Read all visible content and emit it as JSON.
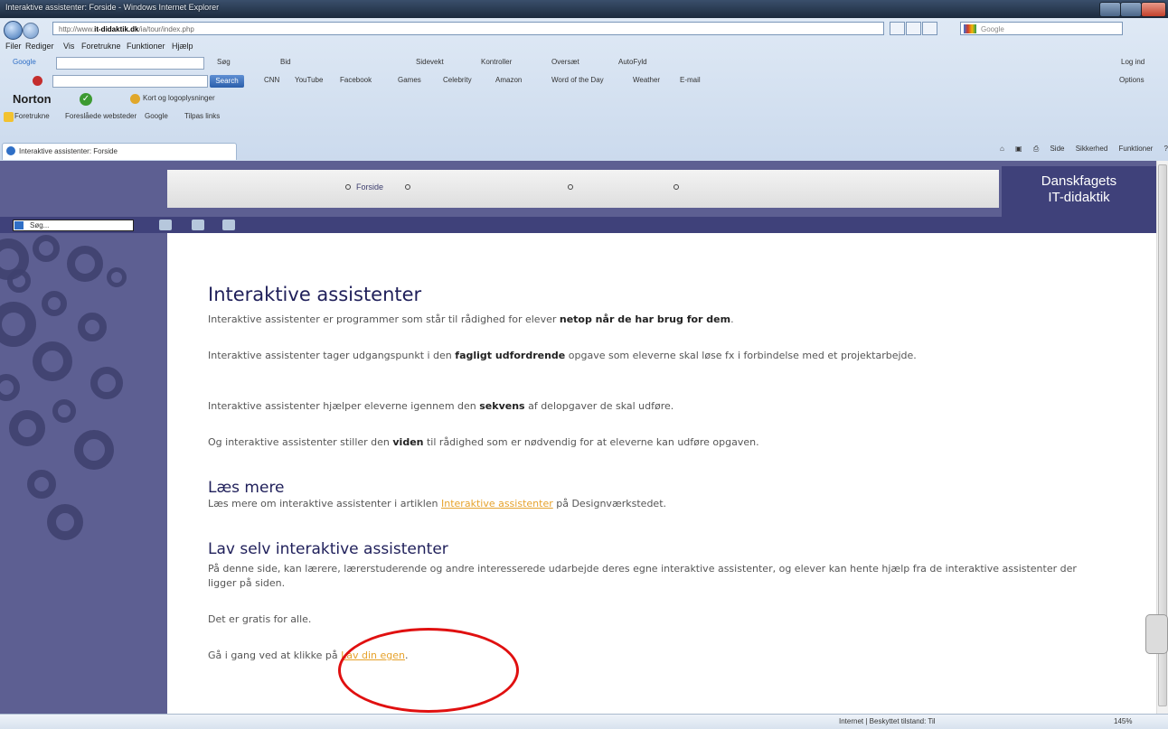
{
  "window": {
    "title": "Interaktive assistenter: Forside - Windows Internet Explorer"
  },
  "addressbar": {
    "url_prefix": "http://www.",
    "url_domain": "it-didaktik.dk",
    "url_rest": "/ia/tour/index.php",
    "search_placeholder": "Google"
  },
  "menubar": [
    "Filer",
    "Rediger",
    "Vis",
    "Foretrukne",
    "Funktioner",
    "Hjælp"
  ],
  "google_toolbar": {
    "label": "Google",
    "search_label": "Søg",
    "items": [
      "Bid",
      "Sidevekt",
      "Kontroller",
      "Oversæt",
      "AutoFyld"
    ],
    "signin": "Log ind"
  },
  "ask_toolbar": {
    "search_button": "Search",
    "items": [
      "CNN",
      "YouTube",
      "Facebook",
      "Games",
      "Celebrity",
      "Amazon",
      "Word of the Day",
      "Weather",
      "E-mail"
    ],
    "options": "Options"
  },
  "norton_toolbar": {
    "brand": "Norton",
    "item": "Kort og logoplysninger"
  },
  "favorites_bar": {
    "favorites": "Foretrukne",
    "items": [
      "Foreslåede websteder",
      "Google",
      "Tilpas links"
    ]
  },
  "tab": {
    "title": "Interaktive assistenter: Forside"
  },
  "command_bar": [
    "Side",
    "Sikkerhed",
    "Funktioner"
  ],
  "banner": {
    "nav_active": "Forside",
    "brand_line1": "Danskfagets",
    "brand_line2": "IT-didaktik"
  },
  "site_search": {
    "placeholder": "Søg..."
  },
  "content": {
    "h1": "Interaktive assistenter",
    "p1_pre": "Interaktive assistenter er programmer som står til rådighed for elever ",
    "p1_bold": "netop når de har brug for dem",
    "p1_post": ".",
    "p2_pre": "Interaktive assistenter tager udgangspunkt i den ",
    "p2_bold": "fagligt udfordrende",
    "p2_post": " opgave som eleverne skal løse fx i forbindelse med et projektarbejde.",
    "p3_pre": "Interaktive assistenter hjælper eleverne igennem den ",
    "p3_bold": "sekvens",
    "p3_post": " af delopgaver de skal udføre.",
    "p4_pre": "Og interaktive assistenter stiller den ",
    "p4_bold": "viden",
    "p4_post": " til rådighed som er nødvendig for at eleverne kan udføre opgaven.",
    "h2_read": "Læs mere",
    "read_pre": "Læs mere om interaktive assistenter i artiklen ",
    "read_link": "Interaktive assistenter",
    "read_post": " på Designværkstedet.",
    "h2_make": "Lav selv interaktive assistenter",
    "make_p1": "På denne side, kan lærere, lærerstuderende og andre interesserede udarbejde deres egne interaktive assistenter, og elever kan hente hjælp fra de interaktive assistenter der ligger på siden.",
    "make_p2": "Det er gratis for alle.",
    "make_p3_pre": "Gå i gang ved at klikke på ",
    "make_link": "Lav din egen",
    "make_p3_post": "."
  },
  "statusbar": {
    "zone": "Internet | Beskyttet tilstand: Til",
    "zoom": "145%"
  },
  "colors": {
    "site_purple": "#5d5f92",
    "site_dark": "#3f417a",
    "link": "#e6a22c",
    "annotation": "#e01010"
  }
}
